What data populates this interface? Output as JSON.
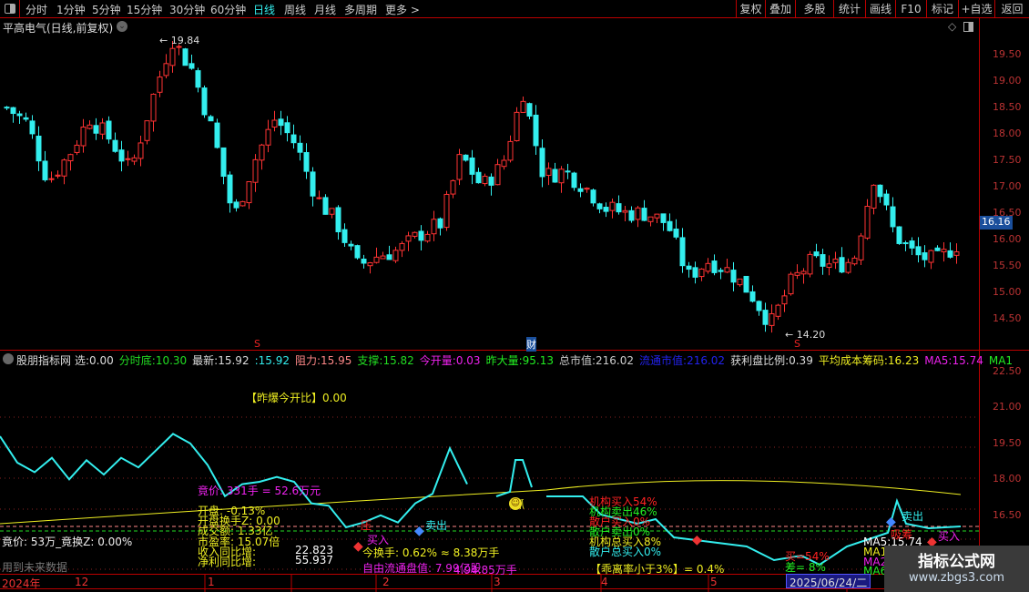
{
  "toolbar": {
    "periods": [
      "分时",
      "1分钟",
      "5分钟",
      "15分钟",
      "30分钟",
      "60分钟",
      "日线",
      "周线",
      "月线",
      "多周期",
      "更多 >"
    ],
    "active": "日线",
    "buttons": [
      "复权",
      "叠加",
      "多股",
      "统计",
      "画线",
      "F10",
      "标记",
      "+自选",
      "返回"
    ]
  },
  "chart_title": "平高电气(日线,前复权)",
  "price_axis": [
    "19.50",
    "19.00",
    "18.50",
    "18.00",
    "17.50",
    "17.00",
    "16.50",
    "16.00",
    "15.50",
    "15.00",
    "14.50"
  ],
  "current_price": "16.16",
  "high_label": "19.84",
  "low_label": "14.20",
  "markers": {
    "s1": "S",
    "cai": "财",
    "s2": "S"
  },
  "price_keypoints": [
    18.5,
    18.2,
    17.1,
    17.6,
    18.3,
    17.9,
    17.3,
    18.6,
    19.8,
    19.2,
    18.0,
    16.4,
    17.5,
    18.3,
    17.8,
    16.8,
    16.3,
    15.5,
    15.7,
    15.8,
    16.1,
    16.3,
    17.6,
    17.0,
    17.4,
    18.8,
    17.2,
    17.3,
    17.0,
    16.6,
    16.5,
    16.5,
    16.3,
    15.3,
    15.6,
    15.4,
    15.0,
    14.4,
    15.2,
    15.6,
    15.5,
    15.6,
    17.2,
    16.1,
    15.7,
    15.6,
    15.9
  ],
  "indicator_header": {
    "name": "股朋指标网",
    "items": [
      {
        "label": "选:",
        "value": "0.00",
        "color": "#ddd"
      },
      {
        "label": "分时底:",
        "value": "10.30",
        "color": "#2d2"
      },
      {
        "label": "最新:",
        "value": "15.92",
        "color": "#ddd"
      },
      {
        "label": ":",
        "value": "15.92",
        "color": "#3ee"
      },
      {
        "label": "阻力:",
        "value": "15.95",
        "color": "#f88"
      },
      {
        "label": "支撑:",
        "value": "15.82",
        "color": "#2d2"
      },
      {
        "label": "今开量:",
        "value": "0.03",
        "color": "#e2e"
      },
      {
        "label": "昨大量:",
        "value": "95.13",
        "color": "#2e2"
      },
      {
        "label": "总市值:",
        "value": "216.02",
        "color": "#ccc"
      },
      {
        "label": "流通市值:",
        "value": "216.02",
        "color": "#22e"
      },
      {
        "label": "获利盘比例:",
        "value": "0.39",
        "color": "#ddd"
      },
      {
        "label": "平均成本筹码:",
        "value": "16.23",
        "color": "#ee2"
      },
      {
        "label": "MA5:",
        "value": "15.74",
        "color": "#e2e"
      },
      {
        "label": "MA1",
        "value": "",
        "color": "#2e2"
      }
    ]
  },
  "indicator_axis": [
    "22.50",
    "21.00",
    "19.50",
    "18.00",
    "16.50"
  ],
  "ind_cyan": [
    19.8,
    18.7,
    18.3,
    18.9,
    18.0,
    18.8,
    18.2,
    18.9,
    18.5,
    19.2,
    19.9,
    19.5,
    18.6,
    17.3,
    17.8,
    17.9,
    18.1,
    17.9,
    17.0,
    16.9,
    16.0,
    16.2,
    16.5,
    16.2,
    17.0,
    17.4,
    19.3,
    17.8
  ],
  "labels": {
    "zbjk": "【昨爆今开比】0.00",
    "jingjia": "竟价: 331手 = 52.6万元",
    "kaipan": "开盘: -0.13%",
    "kphs": "开盘换手Z: 0.00",
    "cje": "成交额: 1.33亿",
    "syl": "市盈率: 15.07倍",
    "srtb": "收入同比增:",
    "srtb_v": "22.823",
    "jltb": "净利同比增:",
    "jltb_v": "55.937",
    "ya": "压",
    "mairu": "买入",
    "maichu": "卖出",
    "zhua": "抓",
    "jhs": "今换手: 0.62% ≈ 8.38万手",
    "zyl": "自由流通盘值: 7.99亿股",
    "zylb": "4.94.85万手",
    "jg1": "机构买入54%",
    "jg2": "机构卖出46%",
    "sh1": "散户买入0%",
    "sh2": "散户卖出0%",
    "jgz": "机构总买入8%",
    "shz": "散户总买入0%",
    "gll": "【乖离率小于3%】= 0.4%",
    "m54": "买=54%",
    "cha": "差= 8%",
    "ma5": "MA5:15.74",
    "ma1": "MA1",
    "ma2": "MA2",
    "ma6": "MA6",
    "xichou": "吸筹",
    "mairu2": "买入",
    "maichu2": "卖出",
    "jj2": "竟价: 53万_竟换Z: 0.00%",
    "wlsj": "用到未来数据"
  },
  "time_axis": {
    "year": "2024年",
    "ticks": [
      "12",
      "1",
      "2",
      "3",
      "4",
      "5",
      "6"
    ],
    "cursor": "2025/06/24/二"
  },
  "watermark": {
    "title": "指标公式网",
    "url": "www.zbgs3.com"
  }
}
